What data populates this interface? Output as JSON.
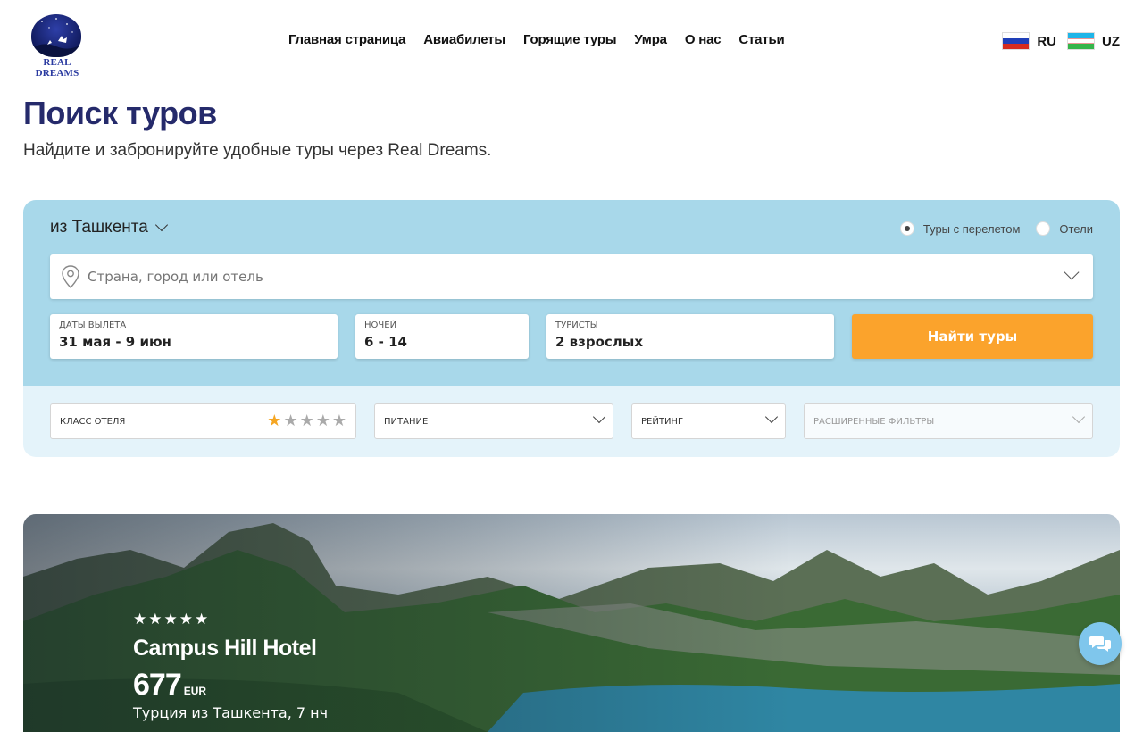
{
  "header": {
    "logo_text": "REAL DREAMS",
    "nav": [
      "Главная страница",
      "Авиабилеты",
      "Горящие туры",
      "Умра",
      "О нас",
      "Статьи"
    ],
    "languages": [
      {
        "code": "RU",
        "flag": "russia-flag-icon"
      },
      {
        "code": "UZ",
        "flag": "uzbekistan-flag-icon"
      }
    ]
  },
  "page": {
    "title": "Поиск туров",
    "subtitle": "Найдите и забронируйте удобные туры через Real Dreams."
  },
  "search": {
    "from_city": "из Ташкента",
    "mode_options": [
      {
        "label": "Туры с перелетом",
        "selected": true
      },
      {
        "label": "Отели",
        "selected": false
      }
    ],
    "destination_placeholder": "Страна, город или отель",
    "dates": {
      "label": "ДАТЫ ВЫЛЕТА",
      "value": "31 мая - 9 июн"
    },
    "nights": {
      "label": "НОЧЕЙ",
      "value": "6 - 14"
    },
    "tourists": {
      "label": "ТУРИСТЫ",
      "value": "2 взрослых"
    },
    "find_button": "Найти туры",
    "filters": {
      "hotel_class": {
        "label": "КЛАСС ОТЕЛЯ",
        "selected_stars": 1,
        "total_stars": 5
      },
      "meals": "ПИТАНИЕ",
      "rating": "РЕЙТИНГ",
      "advanced": "РАСШИРЕННЫЕ ФИЛЬТРЫ"
    }
  },
  "hero": {
    "stars": 5,
    "hotel_name": "Campus Hill Hotel",
    "price": "677",
    "currency": "EUR",
    "description": "Турция из Ташкента, 7 нч"
  },
  "colors": {
    "brand_navy": "#252a6b",
    "search_panel": "#a8d8ea",
    "filter_panel": "#e4f3fa",
    "find_button": "#fba32c",
    "star_active": "#f5a623",
    "chat_button": "#7fc6ec"
  }
}
